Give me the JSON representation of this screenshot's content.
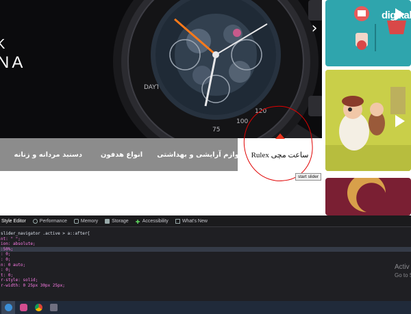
{
  "hero": {
    "line1": "K",
    "line2": "NA",
    "next_glyph": "›"
  },
  "tabs": [
    {
      "label": "ساعت مچی Rulex",
      "active": true
    },
    {
      "label": "لوازم آرایشی و بهداشتی",
      "active": false
    },
    {
      "label": "انواع هدفون",
      "active": false
    },
    {
      "label": "دسنبد مردانه و زنانه",
      "active": false
    }
  ],
  "start_button": {
    "label": "start slider"
  },
  "side_cards": {
    "card1_brand": "digikala",
    "card1_icon": "play-icon",
    "card2_icon": "play-icon"
  },
  "devtools": {
    "tabs": [
      {
        "label": "Style Editor",
        "icon": "style-editor-icon"
      },
      {
        "label": "Performance",
        "icon": "performance-icon"
      },
      {
        "label": "Memory",
        "icon": "memory-icon"
      },
      {
        "label": "Storage",
        "icon": "storage-icon"
      },
      {
        "label": "Accessibility",
        "icon": "accessibility-icon"
      },
      {
        "label": "What's New",
        "icon": "whats-new-icon"
      }
    ],
    "code_lines": [
      "slider_navigator .active > a::after{",
      "nt: \" \";",
      "ion: absolute;",
      ":50%;",
      ": 0;",
      ": 0;",
      "n: 0 auto;",
      ": 0;",
      "t: 0;",
      "r-style: solid;",
      "r-width: 0 25px 30px 25px;",
      ""
    ],
    "selected_line": 3
  },
  "watermark": {
    "line1": "Activ",
    "line2": "Go to S"
  },
  "taskbar": {
    "items": [
      "edge-icon",
      "app-icon",
      "chrome-icon",
      "app-p-icon"
    ]
  },
  "colors": {
    "tab_gray": "#8c8c8c",
    "accent_red": "#e8331d",
    "annotation_red": "#e00000",
    "devtools_bg": "#1f1f23",
    "taskbar_bg": "#202a3a"
  }
}
